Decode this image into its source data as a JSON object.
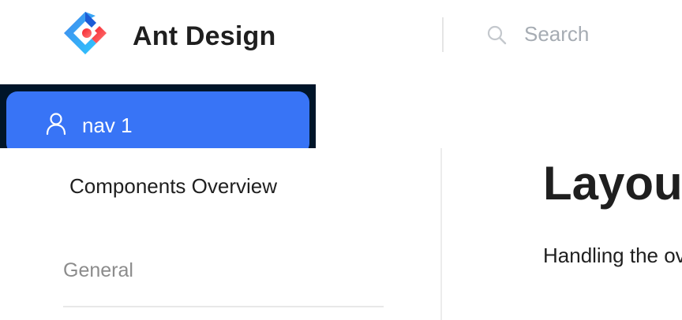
{
  "header": {
    "logo_text": "Ant Design",
    "search_placeholder": "Search"
  },
  "nav": {
    "items": [
      {
        "label": "nav 1",
        "icon": "user-icon",
        "selected": true
      }
    ]
  },
  "side_menu": {
    "overview_link": "Components Overview",
    "group_title": "General"
  },
  "content": {
    "title": "Layout",
    "description": "Handling the overall layout of a page."
  },
  "colors": {
    "nav_background": "#001529",
    "nav_selected": "#3874f6",
    "logo_blue": "#1677ff",
    "logo_red": "#f5222d"
  }
}
